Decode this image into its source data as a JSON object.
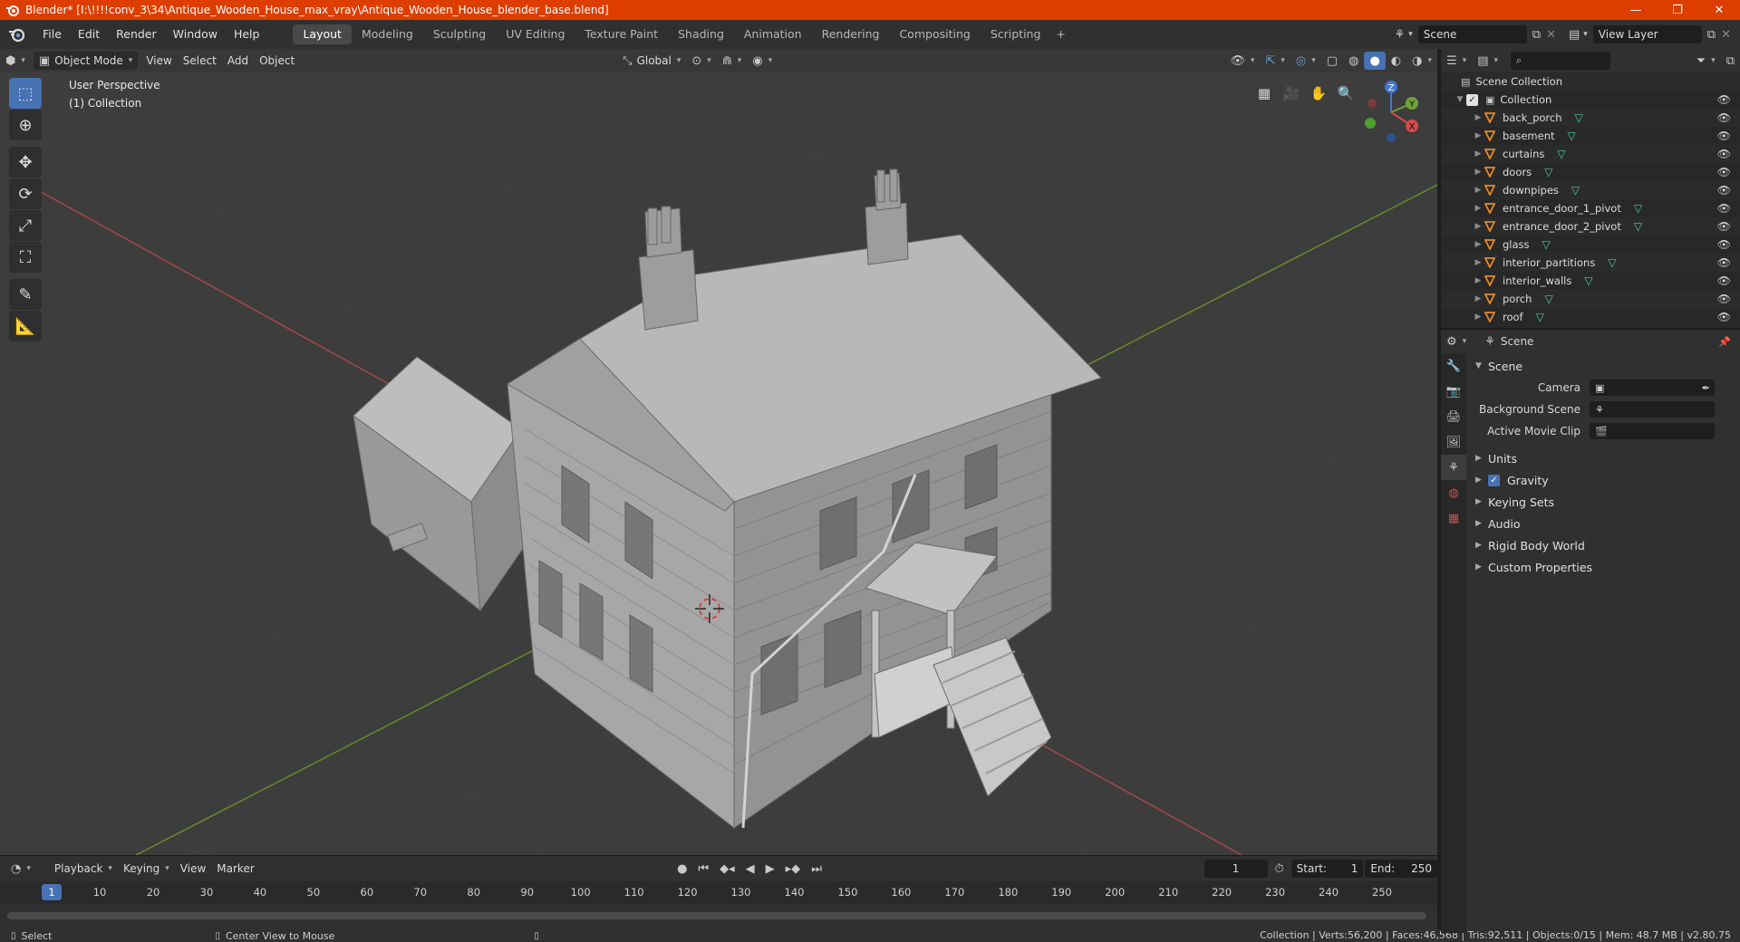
{
  "window": {
    "title": "Blender* [I:\\!!!!conv_3\\34\\Antique_Wooden_House_max_vray\\Antique_Wooden_House_blender_base.blend]",
    "minimize": "—",
    "restore": "❐",
    "close": "✕"
  },
  "menu": [
    "File",
    "Edit",
    "Render",
    "Window",
    "Help"
  ],
  "workspaces": [
    "Layout",
    "Modeling",
    "Sculpting",
    "UV Editing",
    "Texture Paint",
    "Shading",
    "Animation",
    "Rendering",
    "Compositing",
    "Scripting"
  ],
  "workspace_add": "+",
  "scene_selector": "Scene",
  "view_layer": "View Layer",
  "viewport": {
    "mode": "Object Mode",
    "menus": [
      "View",
      "Select",
      "Add",
      "Object"
    ],
    "orientation": "Global",
    "info_line1": "User Perspective",
    "info_line2": "(1) Collection",
    "gizmo": {
      "z": "Z",
      "y": "Y",
      "x": "X"
    }
  },
  "outliner": {
    "scene_collection": "Scene Collection",
    "collection": "Collection",
    "objects": [
      "back_porch",
      "basement",
      "curtains",
      "doors",
      "downpipes",
      "entrance_door_1_pivot",
      "entrance_door_2_pivot",
      "glass",
      "interior_partitions",
      "interior_walls",
      "porch",
      "roof"
    ],
    "search_placeholder": ""
  },
  "properties": {
    "header": "Scene",
    "panel_title": "Scene",
    "camera_label": "Camera",
    "background_scene_label": "Background Scene",
    "active_movie_clip_label": "Active Movie Clip",
    "sections": [
      "Units",
      "Gravity",
      "Keying Sets",
      "Audio",
      "Rigid Body World",
      "Custom Properties"
    ],
    "gravity_checked": true
  },
  "timeline": {
    "menus": [
      "Playback",
      "Keying",
      "View",
      "Marker"
    ],
    "current_frame": "1",
    "start_label": "Start:",
    "start": "1",
    "end_label": "End:",
    "end": "250",
    "ruler": [
      "1",
      "10",
      "20",
      "30",
      "40",
      "50",
      "60",
      "70",
      "80",
      "90",
      "100",
      "110",
      "120",
      "130",
      "140",
      "150",
      "160",
      "170",
      "180",
      "190",
      "200",
      "210",
      "220",
      "230",
      "240",
      "250"
    ]
  },
  "statusbar": {
    "select": "Select",
    "center_view": "Center View to Mouse",
    "stats": "Collection | Verts:56,200 | Faces:46,568 | Tris:92,511 | Objects:0/15 | Mem: 48.7 MB | v2.80.75"
  },
  "colors": {
    "titlebar": "#dd3e00",
    "accent": "#4772b3",
    "viewport_bg": "#3d3d3d",
    "mesh_icon": "#4bd19a",
    "object_icon": "#e58a2d"
  }
}
